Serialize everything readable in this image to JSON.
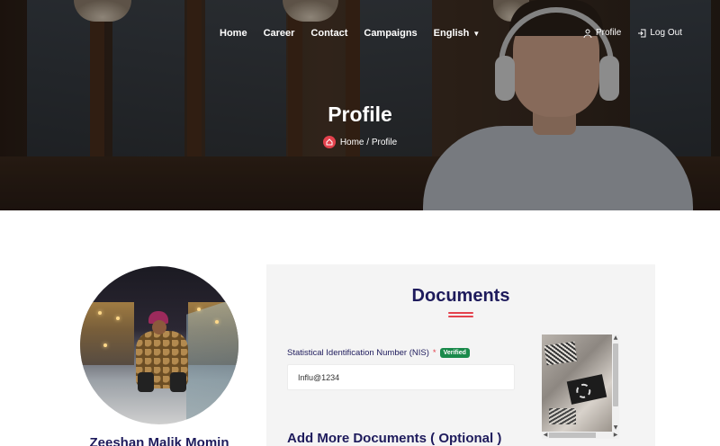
{
  "nav": {
    "items": [
      "Home",
      "Career",
      "Contact",
      "Campaigns"
    ],
    "language": "English"
  },
  "account": {
    "profile_label": "Profile",
    "logout_label": "Log Out"
  },
  "hero": {
    "title": "Profile",
    "breadcrumb": "Home / Profile"
  },
  "user": {
    "name": "Zeeshan Malik Momin"
  },
  "documents": {
    "title": "Documents",
    "field_label": "Statistical Identification Number (NIS)",
    "required_mark": "*",
    "badge": "Verified",
    "field_value": "Influ@1234",
    "more_title": "Add More Documents ( Optional )"
  },
  "colors": {
    "brand_navy": "#1e1b5c",
    "accent_red": "#e4424d",
    "verified_green": "#1a8a4b"
  }
}
